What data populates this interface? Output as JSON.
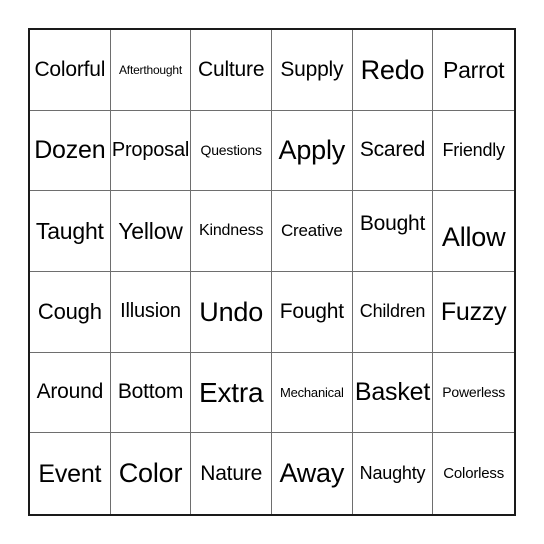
{
  "card": {
    "type": "bingo-card",
    "rows": 6,
    "columns": 6,
    "background_color": "#ffffff",
    "text_color": "#000000",
    "outer_border_color": "#1a1a1a",
    "grid_line_color": "#6e6e6e",
    "cells": [
      {
        "text": "Colorful",
        "font_size": 21,
        "align": "middle"
      },
      {
        "text": "Afterthought",
        "font_size": 12,
        "align": "middle"
      },
      {
        "text": "Culture",
        "font_size": 21,
        "align": "middle"
      },
      {
        "text": "Supply",
        "font_size": 21,
        "align": "middle"
      },
      {
        "text": "Redo",
        "font_size": 27,
        "align": "middle"
      },
      {
        "text": "Parrot",
        "font_size": 23,
        "align": "middle"
      },
      {
        "text": "Dozen",
        "font_size": 25,
        "align": "middle"
      },
      {
        "text": "Proposal",
        "font_size": 20,
        "align": "middle"
      },
      {
        "text": "Questions",
        "font_size": 14,
        "align": "middle"
      },
      {
        "text": "Apply",
        "font_size": 27,
        "align": "middle"
      },
      {
        "text": "Scared",
        "font_size": 21,
        "align": "middle"
      },
      {
        "text": "Friendly",
        "font_size": 18,
        "align": "middle"
      },
      {
        "text": "Taught",
        "font_size": 23,
        "align": "middle"
      },
      {
        "text": "Yellow",
        "font_size": 23,
        "align": "middle"
      },
      {
        "text": "Kindness",
        "font_size": 16,
        "align": "middle"
      },
      {
        "text": "Creative",
        "font_size": 17,
        "align": "middle"
      },
      {
        "text": "Bought",
        "font_size": 21,
        "align": "upper"
      },
      {
        "text": "Allow",
        "font_size": 27,
        "align": "lower"
      },
      {
        "text": "Cough",
        "font_size": 22,
        "align": "middle"
      },
      {
        "text": "Illusion",
        "font_size": 20,
        "align": "middle"
      },
      {
        "text": "Undo",
        "font_size": 27,
        "align": "middle"
      },
      {
        "text": "Fought",
        "font_size": 21,
        "align": "middle"
      },
      {
        "text": "Children",
        "font_size": 18,
        "align": "middle"
      },
      {
        "text": "Fuzzy",
        "font_size": 25,
        "align": "middle"
      },
      {
        "text": "Around",
        "font_size": 21,
        "align": "middle"
      },
      {
        "text": "Bottom",
        "font_size": 21,
        "align": "middle"
      },
      {
        "text": "Extra",
        "font_size": 28,
        "align": "middle"
      },
      {
        "text": "Mechanical",
        "font_size": 13,
        "align": "middle"
      },
      {
        "text": "Basket",
        "font_size": 25,
        "align": "middle"
      },
      {
        "text": "Powerless",
        "font_size": 14,
        "align": "middle"
      },
      {
        "text": "Event",
        "font_size": 25,
        "align": "middle"
      },
      {
        "text": "Color",
        "font_size": 27,
        "align": "middle"
      },
      {
        "text": "Nature",
        "font_size": 21,
        "align": "middle"
      },
      {
        "text": "Away",
        "font_size": 27,
        "align": "middle"
      },
      {
        "text": "Naughty",
        "font_size": 18,
        "align": "middle"
      },
      {
        "text": "Colorless",
        "font_size": 15,
        "align": "middle"
      }
    ]
  }
}
